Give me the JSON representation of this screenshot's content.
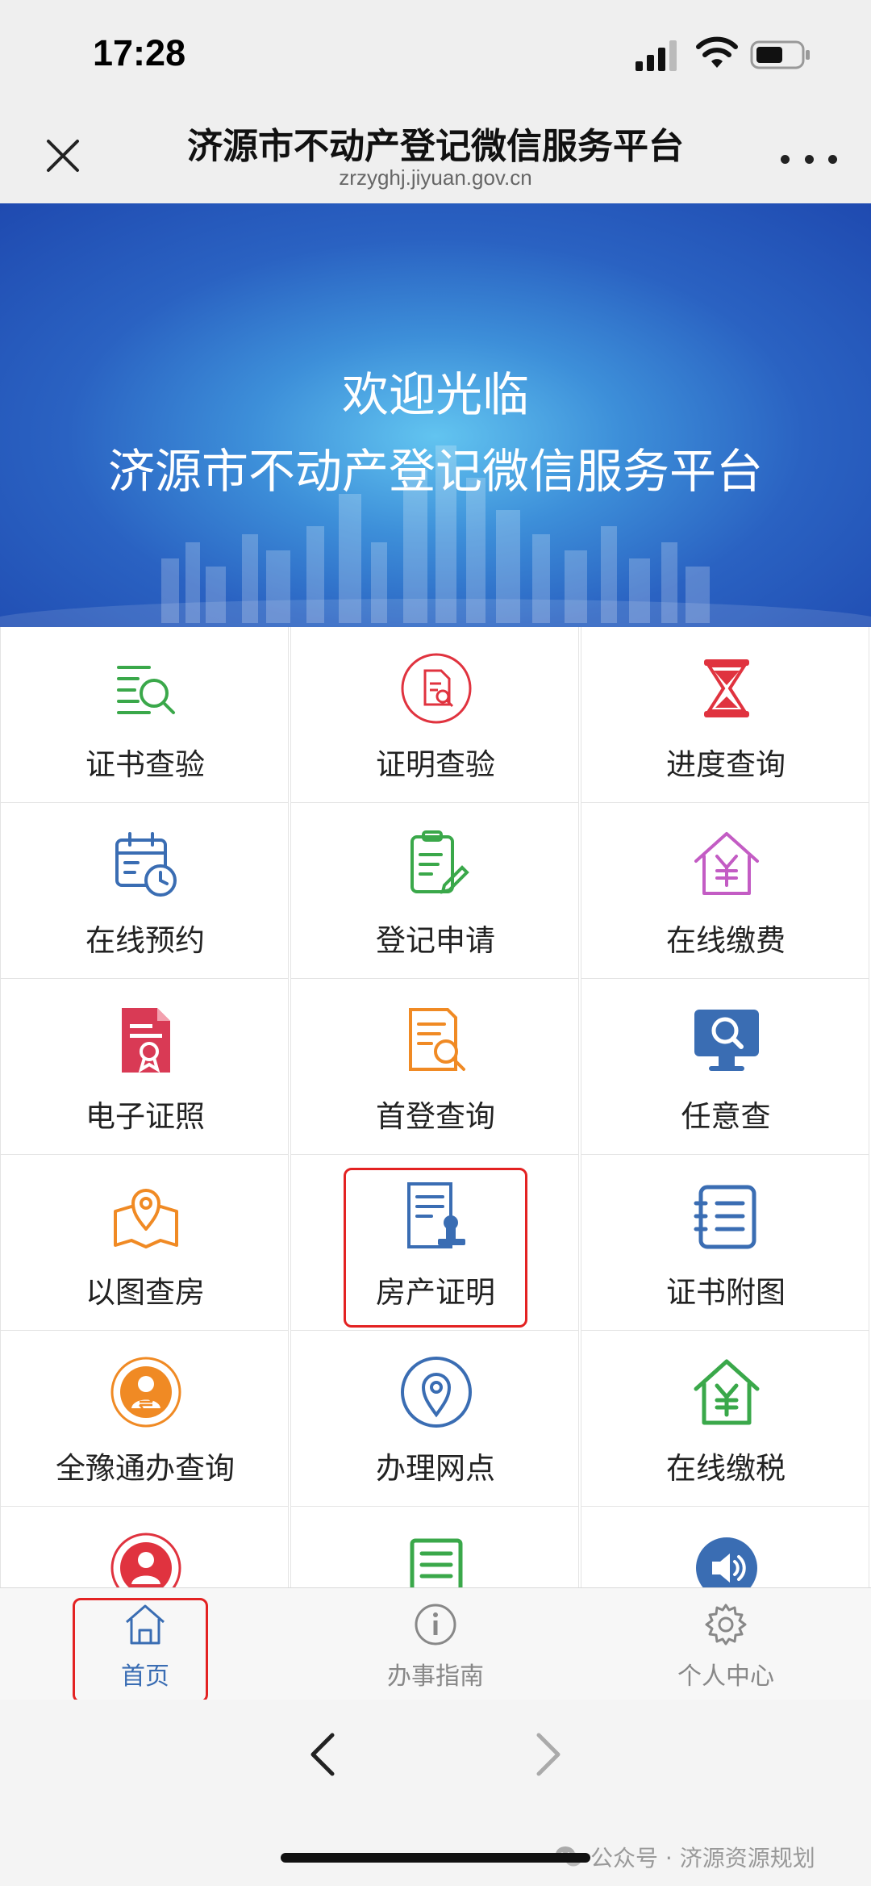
{
  "status": {
    "time": "17:28"
  },
  "header": {
    "title": "济源市不动产登记微信服务平台",
    "url": "zrzyghj.jiyuan.gov.cn"
  },
  "banner": {
    "line1": "欢迎光临",
    "line2": "济源市不动产登记微信服务平台"
  },
  "services": [
    {
      "label": "证书查验",
      "icon": "certificate-search-icon"
    },
    {
      "label": "证明查验",
      "icon": "document-search-icon"
    },
    {
      "label": "进度查询",
      "icon": "hourglass-icon"
    },
    {
      "label": "在线预约",
      "icon": "calendar-clock-icon"
    },
    {
      "label": "登记申请",
      "icon": "clipboard-edit-icon"
    },
    {
      "label": "在线缴费",
      "icon": "house-yen-icon"
    },
    {
      "label": "电子证照",
      "icon": "electronic-certificate-icon"
    },
    {
      "label": "首登查询",
      "icon": "document-magnifier-icon"
    },
    {
      "label": "任意查",
      "icon": "monitor-search-icon"
    },
    {
      "label": "以图查房",
      "icon": "map-pin-icon"
    },
    {
      "label": "房产证明",
      "icon": "property-certificate-icon"
    },
    {
      "label": "证书附图",
      "icon": "list-document-icon"
    },
    {
      "label": "全豫通办查询",
      "icon": "user-exchange-icon"
    },
    {
      "label": "办理网点",
      "icon": "location-pin-icon"
    },
    {
      "label": "在线缴税",
      "icon": "house-tax-icon"
    },
    {
      "label": "",
      "icon": "user-exchange-red-icon"
    },
    {
      "label": "",
      "icon": "notepad-icon"
    },
    {
      "label": "",
      "icon": "speaker-icon"
    }
  ],
  "tabs": [
    {
      "label": "首页",
      "icon": "home-icon",
      "active": true
    },
    {
      "label": "办事指南",
      "icon": "info-icon",
      "active": false
    },
    {
      "label": "个人中心",
      "icon": "gear-icon",
      "active": false
    }
  ],
  "watermark": {
    "text": "公众号 · 济源资源规划"
  },
  "colors": {
    "primary": "#3a6db3",
    "highlight": "#e32222",
    "banner": "#2a62c2"
  }
}
